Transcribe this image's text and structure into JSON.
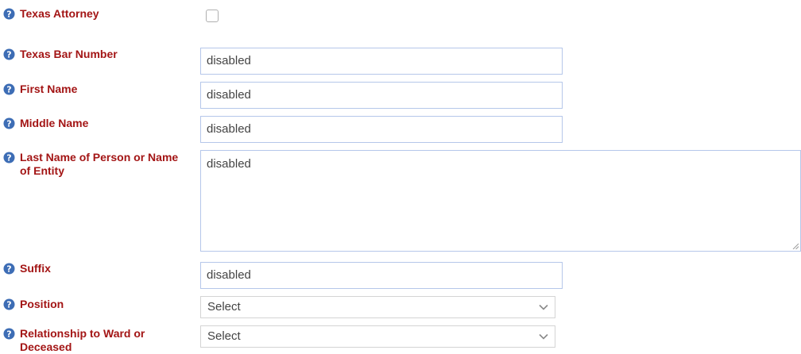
{
  "colors": {
    "label": "#a31515",
    "help_icon": "#3d6db5",
    "input_border": "#b5c7ea",
    "select_border": "#d4d4d4",
    "input_text": "#444444"
  },
  "icons": {
    "help": "question-circle-icon",
    "dropdown": "chevron-down-icon"
  },
  "form": {
    "texas_attorney": {
      "label": "Texas Attorney",
      "checked": false
    },
    "texas_bar_number": {
      "label": "Texas Bar Number",
      "value": "disabled"
    },
    "first_name": {
      "label": "First Name",
      "value": "disabled"
    },
    "middle_name": {
      "label": "Middle Name",
      "value": "disabled"
    },
    "last_name": {
      "label": "Last Name of Person or Name of Entity",
      "value": "disabled"
    },
    "suffix": {
      "label": "Suffix",
      "value": "disabled"
    },
    "position": {
      "label": "Position",
      "selected": "Select"
    },
    "relationship": {
      "label": "Relationship to Ward or Deceased",
      "selected": "Select"
    }
  }
}
